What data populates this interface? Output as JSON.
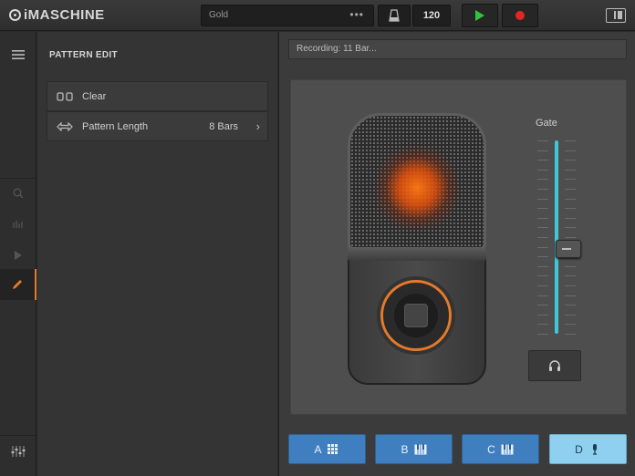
{
  "app": {
    "name": "iMASCHINE"
  },
  "transport": {
    "project_name": "Gold",
    "more_label": "•••",
    "tempo": "120"
  },
  "edit_panel": {
    "title": "PATTERN EDIT",
    "rows": [
      {
        "label": "Clear",
        "value": ""
      },
      {
        "label": "Pattern Length",
        "value": "8 Bars"
      }
    ]
  },
  "main": {
    "status": "Recording: 11 Bar...",
    "gate_label": "Gate",
    "gate_level": 0.44
  },
  "groups": [
    {
      "label": "A",
      "icon": "grid-icon",
      "selected": false
    },
    {
      "label": "B",
      "icon": "keyboard-icon",
      "selected": false
    },
    {
      "label": "C",
      "icon": "keyboard-icon",
      "selected": false
    },
    {
      "label": "D",
      "icon": "mic-icon",
      "selected": true
    }
  ],
  "colors": {
    "accent": "#e47a2a",
    "gate": "#3fc7d6",
    "group": "#3f7fbf",
    "group_selected": "#8fd0f0",
    "play": "#35c23a",
    "record": "#e02626"
  }
}
